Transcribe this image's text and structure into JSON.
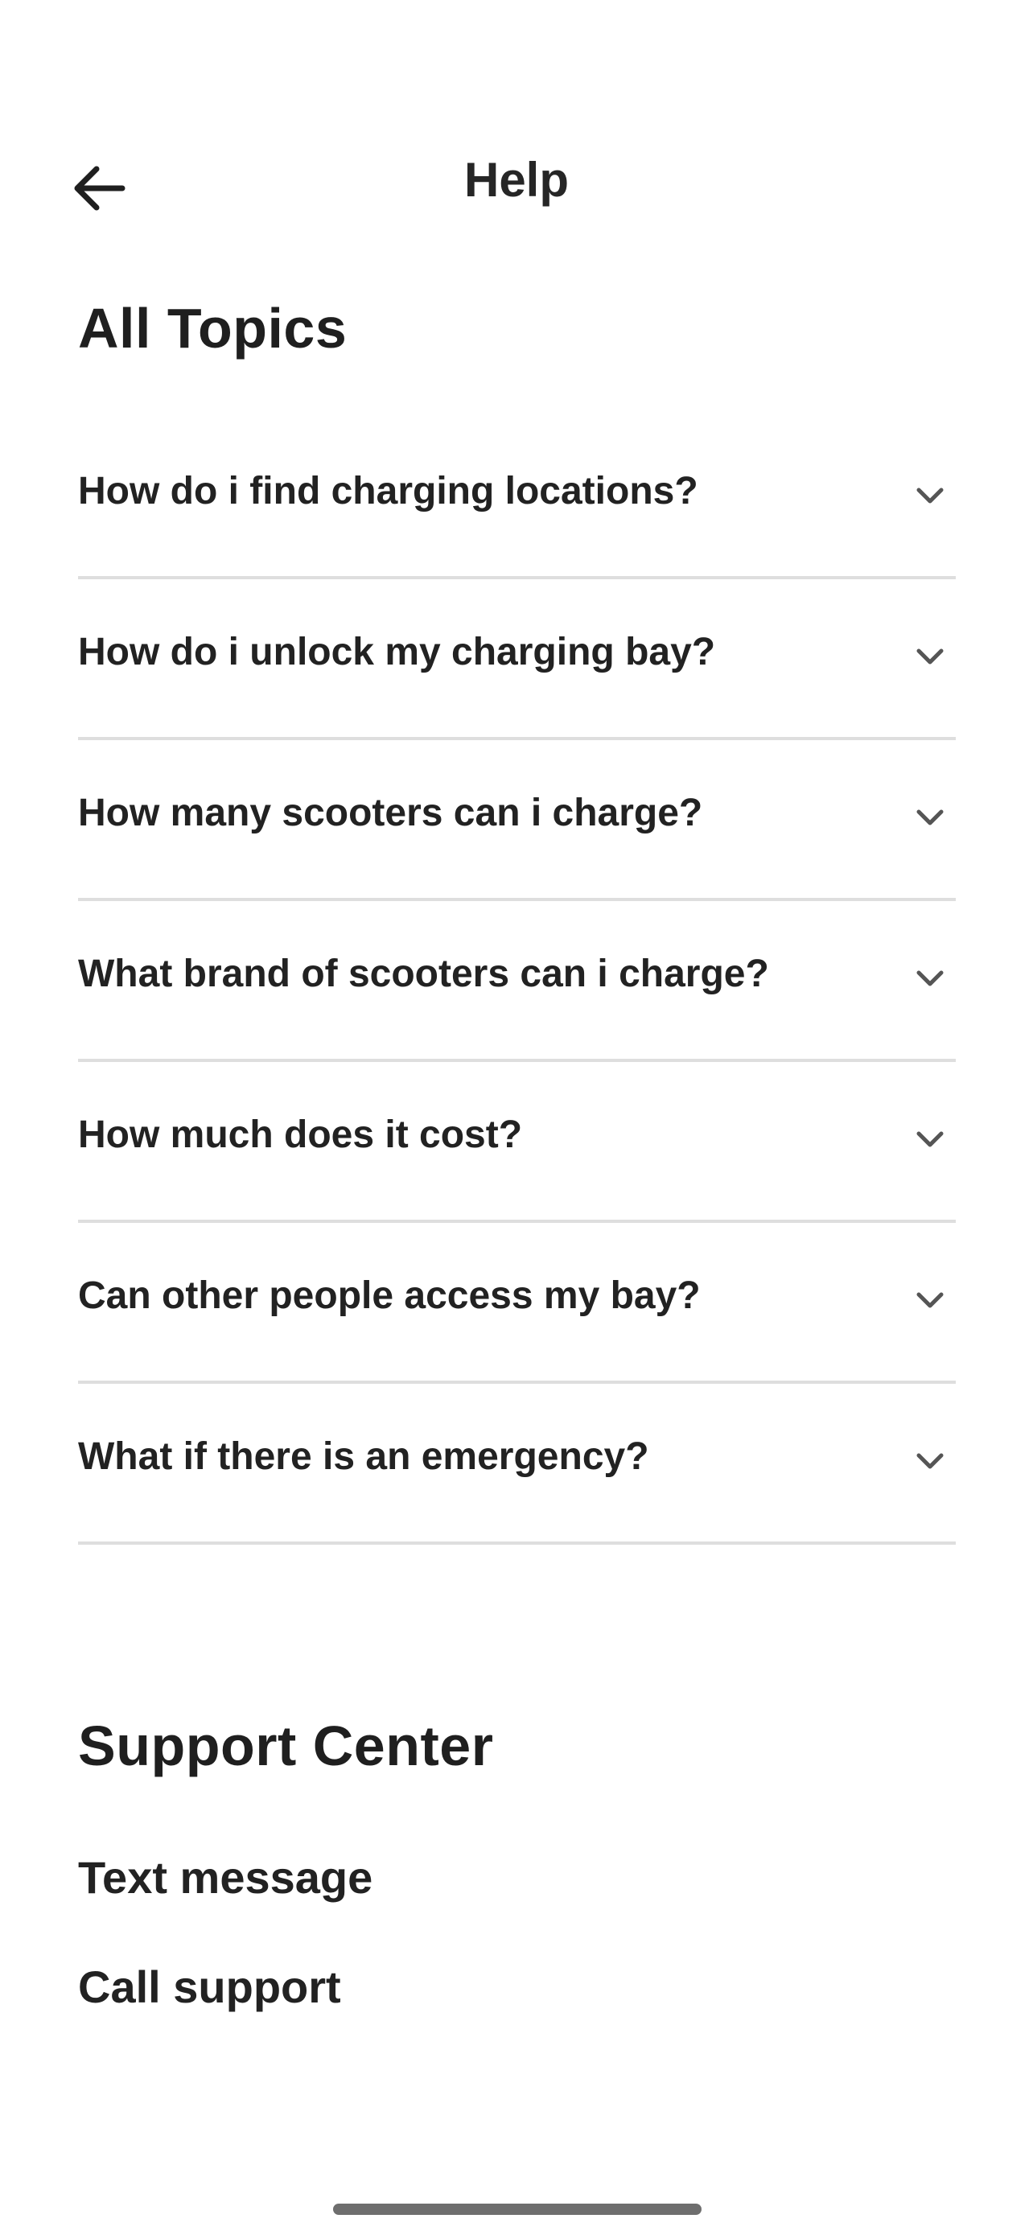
{
  "header": {
    "title": "Help",
    "back_icon": "arrow-left-icon"
  },
  "all_topics": {
    "title": "All Topics",
    "items": [
      {
        "question": "How do i find charging locations?",
        "icon": "chevron-down-icon"
      },
      {
        "question": "How do i unlock my charging bay?",
        "icon": "chevron-down-icon"
      },
      {
        "question": "How many scooters can i charge?",
        "icon": "chevron-down-icon"
      },
      {
        "question": "What brand of scooters can i charge?",
        "icon": "chevron-down-icon"
      },
      {
        "question": "How much does it cost?",
        "icon": "chevron-down-icon"
      },
      {
        "question": "Can other people access my bay?",
        "icon": "chevron-down-icon"
      },
      {
        "question": "What if there is an emergency?",
        "icon": "chevron-down-icon"
      }
    ]
  },
  "support_center": {
    "title": "Support Center",
    "links": [
      {
        "label": "Text message"
      },
      {
        "label": "Call support"
      }
    ]
  },
  "colors": {
    "background": "#ffffff",
    "text": "#1f1f1f",
    "divider": "#dedede",
    "chevron": "#555555",
    "home_indicator": "#6e6e6e"
  }
}
